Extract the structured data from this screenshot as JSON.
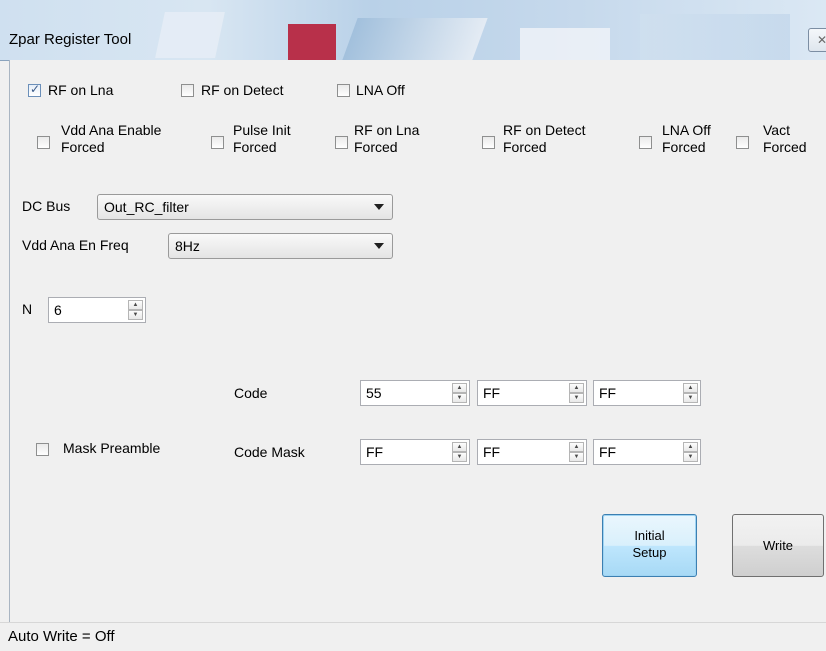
{
  "window": {
    "title": "Zpar Register Tool",
    "close_glyph": "✕"
  },
  "checkboxes_row1": [
    {
      "label": "RF on Lna",
      "checked": true
    },
    {
      "label": "RF on Detect",
      "checked": false
    },
    {
      "label": "LNA Off",
      "checked": false
    }
  ],
  "checkboxes_row2": [
    {
      "label": "Vdd Ana Enable\nForced",
      "checked": false
    },
    {
      "label": "Pulse Init\nForced",
      "checked": false
    },
    {
      "label": "RF on Lna\nForced",
      "checked": false
    },
    {
      "label": "RF on Detect\nForced",
      "checked": false
    },
    {
      "label": "LNA Off\nForced",
      "checked": false
    },
    {
      "label": "Vact\nForced",
      "checked": false
    }
  ],
  "dc_bus": {
    "label": "DC Bus",
    "value": "Out_RC_filter"
  },
  "vdd_freq": {
    "label": "Vdd Ana En Freq",
    "value": "8Hz"
  },
  "n_field": {
    "label": "N",
    "value": "6"
  },
  "code": {
    "label": "Code",
    "values": [
      "55",
      "FF",
      "FF"
    ]
  },
  "code_mask": {
    "label": "Code Mask",
    "values": [
      "FF",
      "FF",
      "FF"
    ]
  },
  "mask_preamble": {
    "label": "Mask Preamble",
    "checked": false
  },
  "buttons": {
    "initial_setup": "Initial\nSetup",
    "write": "Write"
  },
  "status": {
    "text": "Auto Write = Off"
  },
  "icons": {
    "check": "✓",
    "spin_up": "▲",
    "spin_down": "▼"
  }
}
